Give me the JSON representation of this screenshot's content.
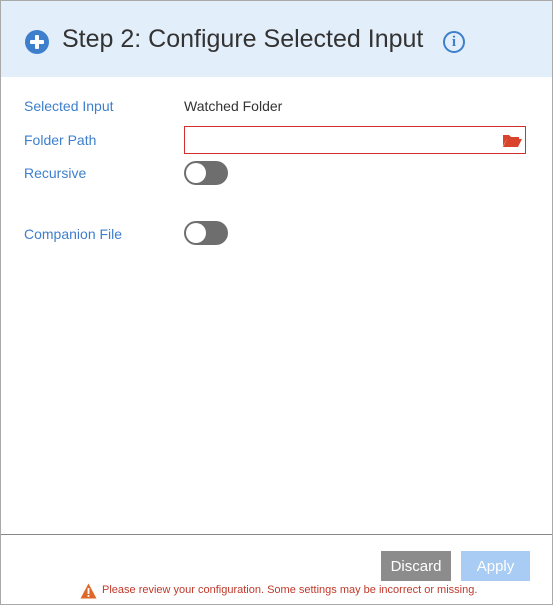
{
  "header": {
    "title": "Step 2: Configure Selected Input",
    "icon": "plus-circle-icon",
    "info_icon": "info-icon",
    "accent_color": "#3d7fcc"
  },
  "form": {
    "selected_input": {
      "label": "Selected Input",
      "value": "Watched Folder"
    },
    "folder_path": {
      "label": "Folder Path",
      "value": "",
      "placeholder": "",
      "icon": "folder-open-icon"
    },
    "recursive": {
      "label": "Recursive",
      "enabled": false
    },
    "companion_file": {
      "label": "Companion File",
      "enabled": false
    }
  },
  "footer": {
    "discard_label": "Discard",
    "apply_label": "Apply",
    "warning_text": "Please review your configuration. Some settings may be incorrect or missing.",
    "warning_icon": "warning-triangle-icon",
    "warning_color": "#c0392b"
  }
}
